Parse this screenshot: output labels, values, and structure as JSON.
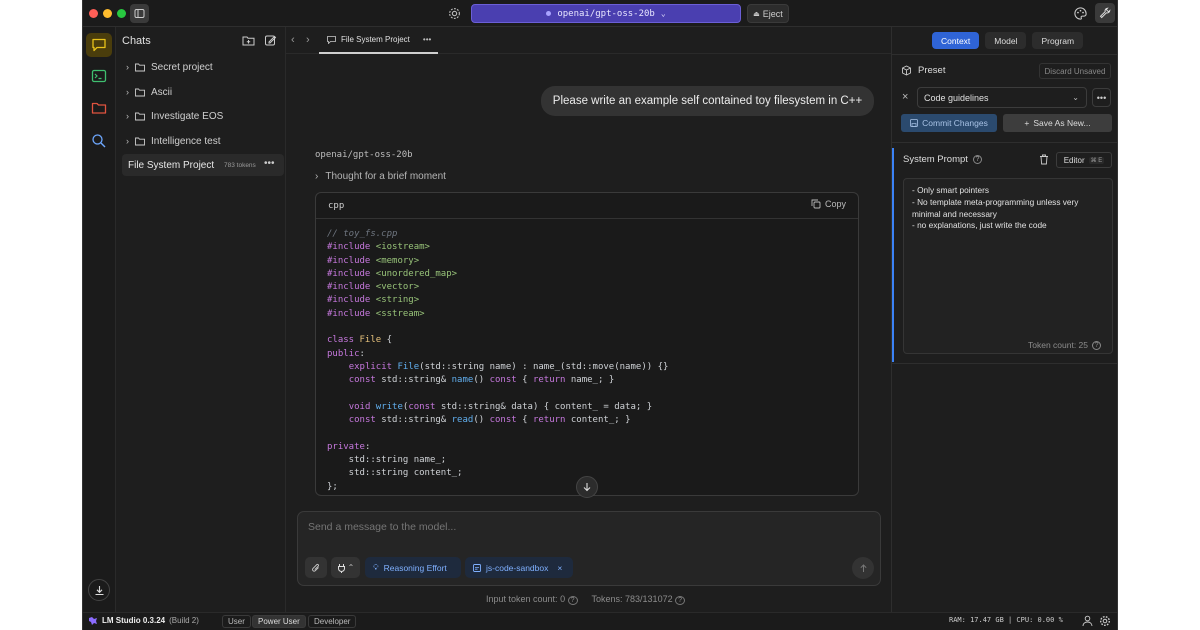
{
  "titlebar": {
    "model_name": "openai/gpt-oss-20b",
    "eject_label": "Eject"
  },
  "chats": {
    "header": "Chats",
    "folders": [
      "Secret project",
      "Ascii",
      "Investigate EOS",
      "Intelligence test"
    ],
    "active_chat": {
      "name": "File System Project",
      "tokens": "783 tokens"
    }
  },
  "tab": {
    "title": "File System Project"
  },
  "conversation": {
    "user_message": "Please write an example self contained toy filesystem in C++",
    "assistant_name": "openai/gpt-oss-20b",
    "thought_label": "Thought for a brief moment",
    "code_lang": "cpp",
    "copy_label": "Copy"
  },
  "composer": {
    "placeholder": "Send a message to the model...",
    "reasoning_label": "Reasoning Effort",
    "plugin_label": "js-code-sandbox",
    "input_tokens_label": "Input token count:",
    "input_tokens_value": "0",
    "tokens_label": "Tokens: 783/131072"
  },
  "right_panel": {
    "tabs": [
      "Context",
      "Model",
      "Program"
    ],
    "active_tab": "Context",
    "preset_label": "Preset",
    "discard_label": "Discard Unsaved",
    "preset_value": "Code guidelines",
    "commit_label": "Commit Changes",
    "save_as_label": "Save As New...",
    "system_prompt_label": "System Prompt",
    "editor_label": "Editor",
    "editor_shortcut": "⌘ E",
    "system_prompt_text": "- Only smart pointers\n- No template meta-programming unless very minimal and necessary\n- no explanations, just write the code",
    "token_count": "Token count: 25"
  },
  "statusbar": {
    "app_name": "LM Studio 0.3.24",
    "build": "(Build 2)",
    "modes": [
      "User",
      "Power User",
      "Developer"
    ],
    "active_mode": "Power User",
    "stats": "RAM: 17.47 GB  |  CPU: 0.00 %"
  },
  "colors": {
    "accent_blue": "#2f64d6",
    "model_purple": "#4a3fb0",
    "active_rail": "#d4b106"
  }
}
